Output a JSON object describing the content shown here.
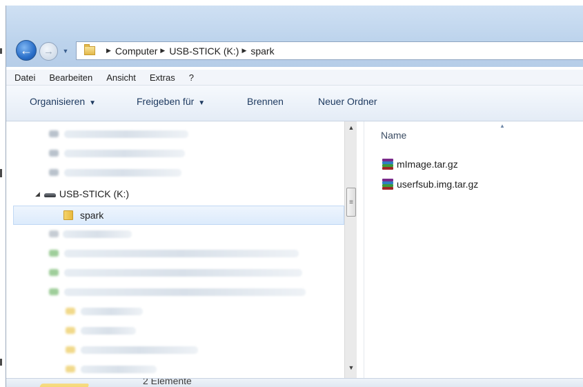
{
  "address_bar": {
    "breadcrumbs": [
      "Computer",
      "USB-STICK (K:)",
      "spark"
    ],
    "folder_icon": "folder-icon"
  },
  "menu": {
    "items": [
      "Datei",
      "Bearbeiten",
      "Ansicht",
      "Extras",
      "?"
    ]
  },
  "toolbar": {
    "organize": "Organisieren",
    "share": "Freigeben für",
    "burn": "Brennen",
    "new_folder": "Neuer Ordner"
  },
  "nav_tree": {
    "drive_label": "USB-STICK (K:)",
    "selected_folder": "spark"
  },
  "file_list": {
    "column_name": "Name",
    "files": [
      "mImage.tar.gz",
      "userfsub.img.tar.gz"
    ]
  },
  "status": {
    "count": "2 Elemente"
  },
  "colors": {
    "chrome": "#bcd3ec",
    "selection": "#dcebfc",
    "accent": "#2a6fc9"
  }
}
